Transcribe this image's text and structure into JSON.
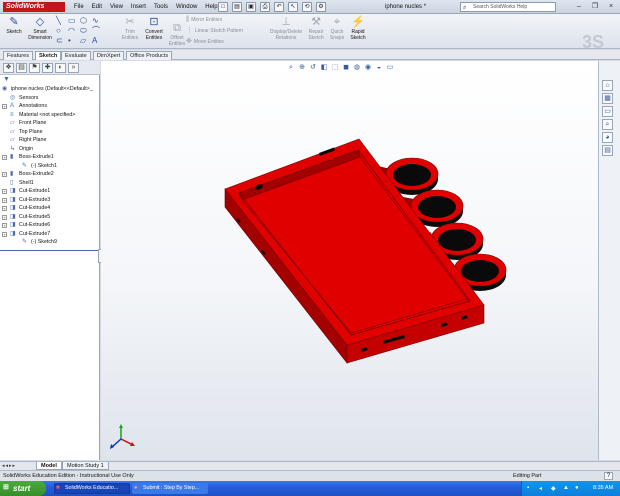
{
  "app": {
    "logo_text": "SolidWorks",
    "document_title": "iphone nucles *"
  },
  "menu": [
    "File",
    "Edit",
    "View",
    "Insert",
    "Tools",
    "Window",
    "Help"
  ],
  "help_search": {
    "placeholder": "Search SolidWorks Help"
  },
  "window_controls": [
    "–",
    "❐",
    "×"
  ],
  "command_manager": {
    "sketch_label": "Sketch",
    "smart_dimension_label": "Smart Dimension",
    "trim_label": "Trim Entities",
    "convert_label": "Convert Entities",
    "offset_label": "Offset Entities",
    "mirror_label": "Mirror Entities",
    "linear_pattern_label": "Linear Sketch Pattern",
    "move_label": "Move Entities",
    "display_delete_label": "Display/Delete Relations",
    "repair_label": "Repair Sketch",
    "quick_snaps_label": "Quick Snaps",
    "rapid_sketch_label": "Rapid Sketch"
  },
  "ribbon_tabs": [
    {
      "label": "Features",
      "active": false
    },
    {
      "label": "Sketch",
      "active": true
    },
    {
      "label": "Evaluate",
      "active": false
    },
    {
      "label": "DimXpert",
      "active": false
    },
    {
      "label": "Office Products",
      "active": false
    }
  ],
  "feature_tree": {
    "root": "iphone nucles (Default<<Default>_",
    "items": [
      {
        "label": "Sensors",
        "indent": 1,
        "expander": false,
        "icon": "sensor-icon"
      },
      {
        "label": "Annotations",
        "indent": 1,
        "expander": true,
        "icon": "annotation-icon"
      },
      {
        "label": "Material <not specified>",
        "indent": 1,
        "expander": false,
        "icon": "material-icon"
      },
      {
        "label": "Front Plane",
        "indent": 1,
        "expander": false,
        "icon": "plane-icon"
      },
      {
        "label": "Top Plane",
        "indent": 1,
        "expander": false,
        "icon": "plane-icon"
      },
      {
        "label": "Right Plane",
        "indent": 1,
        "expander": false,
        "icon": "plane-icon"
      },
      {
        "label": "Origin",
        "indent": 1,
        "expander": false,
        "icon": "origin-icon"
      },
      {
        "label": "Boss-Extrude1",
        "indent": 1,
        "expander": true,
        "icon": "extrude-icon"
      },
      {
        "label": "(-) Sketch1",
        "indent": 2,
        "expander": false,
        "icon": "sketch-icon"
      },
      {
        "label": "Boss-Extrude2",
        "indent": 1,
        "expander": true,
        "icon": "extrude-icon"
      },
      {
        "label": "Shell1",
        "indent": 1,
        "expander": false,
        "icon": "shell-icon"
      },
      {
        "label": "Cut-Extrude1",
        "indent": 1,
        "expander": true,
        "icon": "cut-icon"
      },
      {
        "label": "Cut-Extrude3",
        "indent": 1,
        "expander": true,
        "icon": "cut-icon"
      },
      {
        "label": "Cut-Extrude4",
        "indent": 1,
        "expander": true,
        "icon": "cut-icon"
      },
      {
        "label": "Cut-Extrude5",
        "indent": 1,
        "expander": true,
        "icon": "cut-icon"
      },
      {
        "label": "Cut-Extrude6",
        "indent": 1,
        "expander": true,
        "icon": "cut-icon"
      },
      {
        "label": "Cut-Extrude7",
        "indent": 1,
        "expander": true,
        "icon": "cut-icon"
      },
      {
        "label": "(-) Sketch9",
        "indent": 2,
        "expander": false,
        "icon": "sketch-icon"
      }
    ]
  },
  "colors": {
    "model_red": "#e00000",
    "model_red_dark": "#a30000",
    "model_black": "#0a0a0a",
    "brand_red": "#c01818"
  },
  "model_tabs": [
    {
      "label": "Model",
      "active": true
    },
    {
      "label": "Motion Study 1",
      "active": false
    }
  ],
  "status": {
    "left": "SolidWorks Education Edition - Instructional Use Only",
    "right": "Editing Part",
    "help": "?"
  },
  "taskbar": {
    "start_label": "start",
    "tasks": [
      {
        "label": "SolidWorks Educatio..."
      },
      {
        "label": "Submit : Step By Step..."
      }
    ],
    "clock": "8:35 AM"
  }
}
